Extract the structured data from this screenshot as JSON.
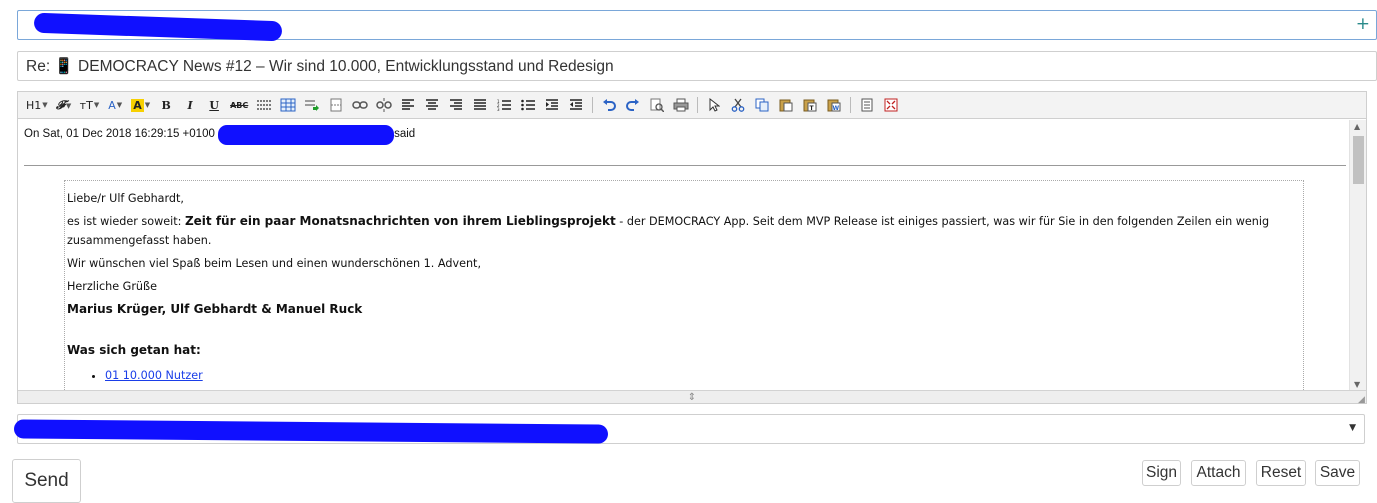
{
  "compose": {
    "to_plus": "+",
    "subject": "Re: 📱 DEMOCRACY News #12 – Wir sind 10.000, Entwicklungsstand und Redesign"
  },
  "toolbar": {
    "heading": "H1",
    "font": "𝓕",
    "size": "тT",
    "font_color": "A",
    "highlight": "A",
    "bold": "B",
    "italic": "I",
    "underline": "U",
    "strike": "ABC"
  },
  "editor": {
    "quote_prefix": "On Sat, 01 Dec 2018 16:29:15 +0100 ",
    "quote_suffix": "said",
    "greeting": "Liebe/r Ulf Gebhardt,",
    "intro_start": "es ist wieder soweit: ",
    "intro_bold": "Zeit für ein paar Monatsnachrichten von ihrem Lieblingsprojekt",
    "intro_end": " - der DEMOCRACY App. Seit dem MVP Release ist einiges passiert, was wir für Sie in den folgenden Zeilen ein wenig zusammengefasst haben.",
    "wish": "Wir wünschen viel Spaß beim Lesen und einen wunderschönen 1. Advent,",
    "regards": "Herzliche Grüße",
    "signature": "Marius Krüger, Ulf Gebhardt & Manuel Ruck",
    "section_heading": "Was sich getan hat:",
    "list_items": [
      "01 10.000 Nutzer"
    ]
  },
  "buttons": {
    "send": "Send",
    "sign": "Sign",
    "attach": "Attach",
    "reset": "Reset",
    "save": "Save"
  },
  "colors": {
    "redaction": "#1010ff",
    "link": "#1a3ee8",
    "to_border": "#7aa7d9"
  }
}
